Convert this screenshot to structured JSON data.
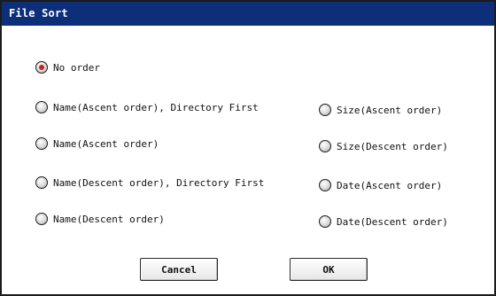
{
  "dialog": {
    "title": "File Sort",
    "selected": "no_order",
    "options": {
      "no_order": "No order",
      "name_asc_dir_first": "Name(Ascent order), Directory First",
      "name_asc": "Name(Ascent order)",
      "name_desc_dir_first": "Name(Descent order), Directory First",
      "name_desc": "Name(Descent order)",
      "size_asc": "Size(Ascent order)",
      "size_desc": "Size(Descent order)",
      "date_asc": "Date(Ascent order)",
      "date_desc": "Date(Descent order)"
    },
    "buttons": {
      "cancel": "Cancel",
      "ok": "OK"
    }
  }
}
